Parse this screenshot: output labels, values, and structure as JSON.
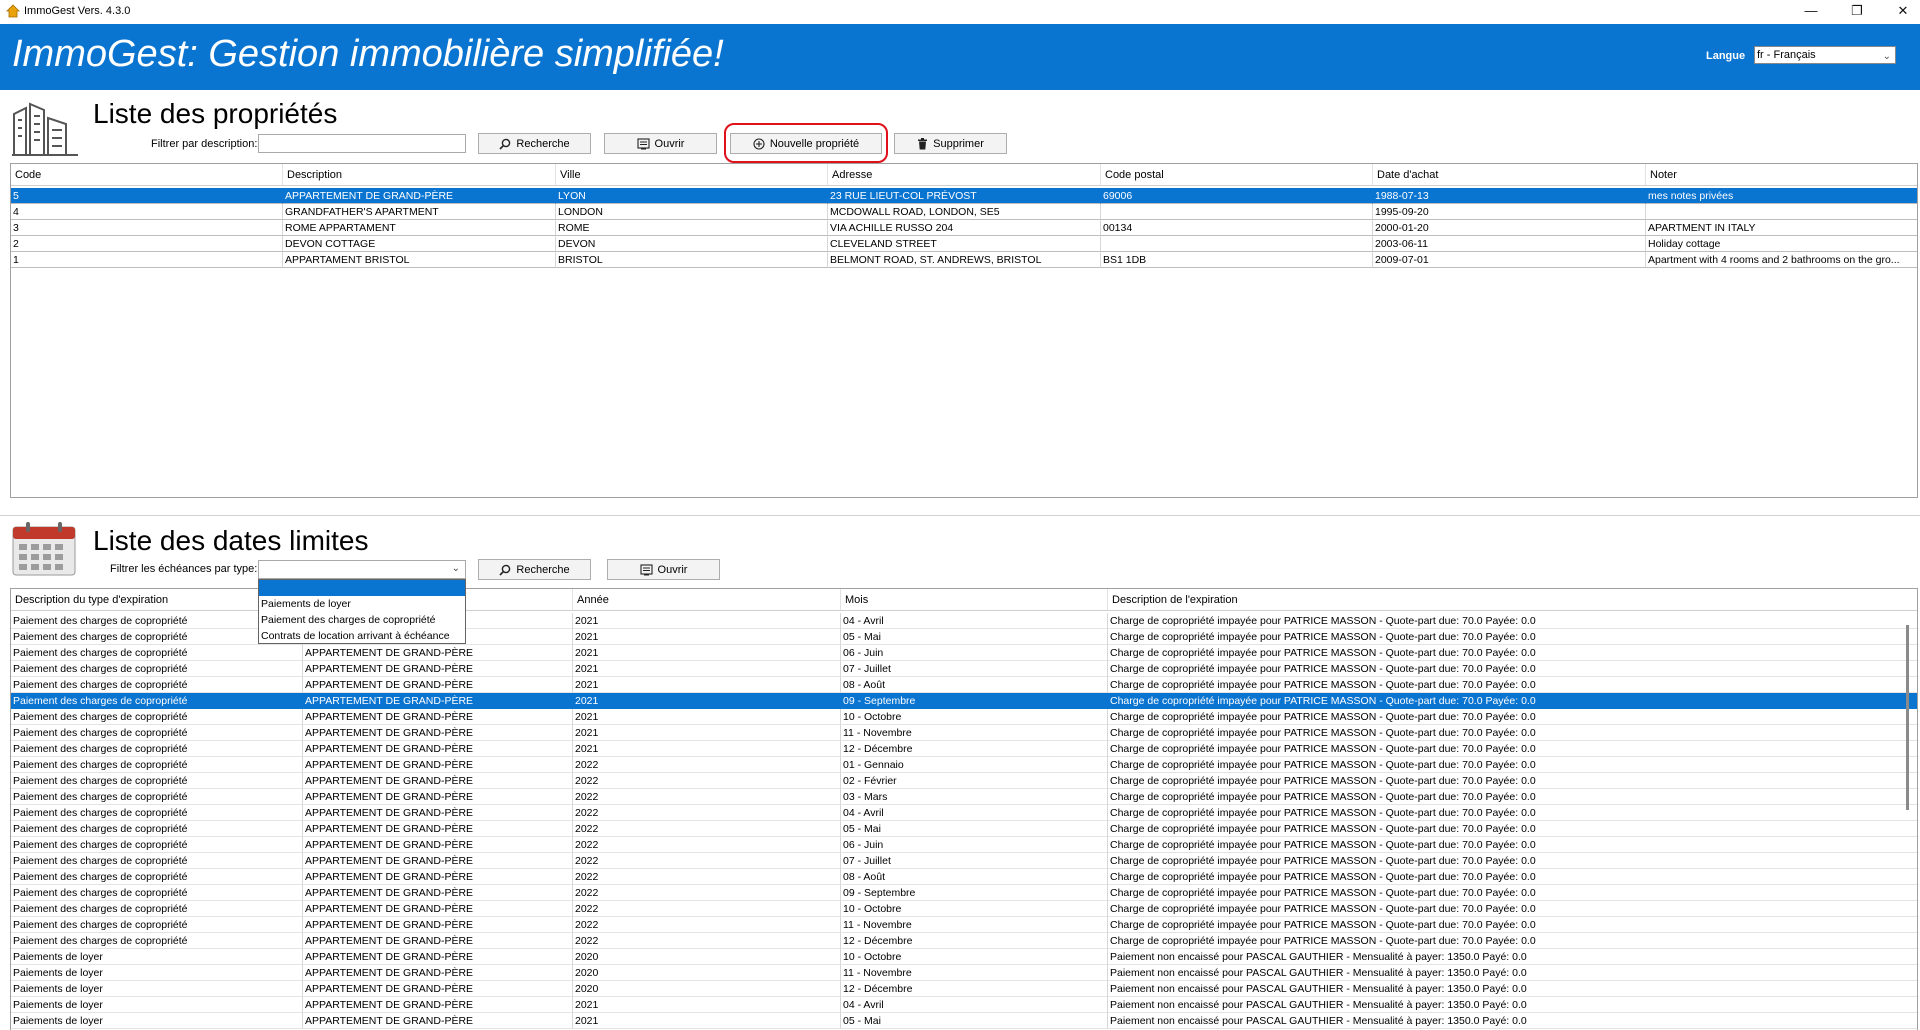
{
  "window": {
    "title": "ImmoGest Vers. 4.3.0"
  },
  "header": {
    "title": "ImmoGest: Gestion immobilière simplifiée!",
    "language_label": "Langue",
    "language_value": "fr - Français"
  },
  "properties": {
    "section_title": "Liste des propriétés",
    "filter_label": "Filtrer par description:",
    "filter_value": "",
    "buttons": {
      "search": "Recherche",
      "open": "Ouvrir",
      "new": "Nouvelle propriété",
      "delete": "Supprimer"
    },
    "columns": [
      "Code",
      "Description",
      "Ville",
      "Adresse",
      "Code postal",
      "Date d'achat",
      "Noter"
    ],
    "selected_row": 0,
    "rows": [
      [
        "5",
        "APPARTEMENT DE GRAND-PÈRE",
        "LYON",
        "23 RUE LIEUT-COL PRÉVOST",
        "69006",
        "1988-07-13",
        "mes notes privées"
      ],
      [
        "4",
        "GRANDFATHER'S APARTMENT",
        "LONDON",
        "MCDOWALL ROAD, LONDON, SE5",
        "",
        "1995-09-20",
        ""
      ],
      [
        "3",
        "ROME APPARTAMENT",
        "ROME",
        "VIA ACHILLE RUSSO 204",
        "00134",
        "2000-01-20",
        "APARTMENT IN ITALY"
      ],
      [
        "2",
        "DEVON COTTAGE",
        "DEVON",
        "CLEVELAND STREET",
        "",
        "2003-06-11",
        "Holiday cottage"
      ],
      [
        "1",
        "APPARTAMENT BRISTOL",
        "BRISTOL",
        "BELMONT ROAD, ST. ANDREWS, BRISTOL",
        "BS1 1DB",
        "2009-07-01",
        "Apartment with 4 rooms and 2 bathrooms on the gro..."
      ]
    ]
  },
  "deadlines": {
    "section_title": "Liste des dates limites",
    "filter_label": "Filtrer les échéances par type:",
    "filter_value": "",
    "type_options": [
      "",
      "Paiements de loyer",
      "Paiement des charges de copropriété",
      "Contrats de location arrivant à échéance"
    ],
    "buttons": {
      "search": "Recherche",
      "open": "Ouvrir"
    },
    "columns": [
      "Description du type d'expiration",
      "",
      "Année",
      "Mois",
      "Description de l'expiration"
    ],
    "selected_row": 5,
    "rows": [
      [
        "Paiement des charges de copropriété",
        "",
        "2021",
        "04 - Avril",
        "Charge de copropriété impayée pour PATRICE MASSON - Quote-part due: 70.0 Payée: 0.0"
      ],
      [
        "Paiement des charges de copropriété",
        "",
        "2021",
        "05 - Mai",
        "Charge de copropriété impayée pour PATRICE MASSON - Quote-part due: 70.0 Payée: 0.0"
      ],
      [
        "Paiement des charges de copropriété",
        "APPARTEMENT DE GRAND-PÈRE",
        "2021",
        "06 - Juin",
        "Charge de copropriété impayée pour PATRICE MASSON - Quote-part due: 70.0 Payée: 0.0"
      ],
      [
        "Paiement des charges de copropriété",
        "APPARTEMENT DE GRAND-PÈRE",
        "2021",
        "07 - Juillet",
        "Charge de copropriété impayée pour PATRICE MASSON - Quote-part due: 70.0 Payée: 0.0"
      ],
      [
        "Paiement des charges de copropriété",
        "APPARTEMENT DE GRAND-PÈRE",
        "2021",
        "08 - Août",
        "Charge de copropriété impayée pour PATRICE MASSON - Quote-part due: 70.0 Payée: 0.0"
      ],
      [
        "Paiement des charges de copropriété",
        "APPARTEMENT DE GRAND-PÈRE",
        "2021",
        "09 - Septembre",
        "Charge de copropriété impayée pour PATRICE MASSON - Quote-part due: 70.0 Payée: 0.0"
      ],
      [
        "Paiement des charges de copropriété",
        "APPARTEMENT DE GRAND-PÈRE",
        "2021",
        "10 - Octobre",
        "Charge de copropriété impayée pour PATRICE MASSON - Quote-part due: 70.0 Payée: 0.0"
      ],
      [
        "Paiement des charges de copropriété",
        "APPARTEMENT DE GRAND-PÈRE",
        "2021",
        "11 - Novembre",
        "Charge de copropriété impayée pour PATRICE MASSON - Quote-part due: 70.0 Payée: 0.0"
      ],
      [
        "Paiement des charges de copropriété",
        "APPARTEMENT DE GRAND-PÈRE",
        "2021",
        "12 - Décembre",
        "Charge de copropriété impayée pour PATRICE MASSON - Quote-part due: 70.0 Payée: 0.0"
      ],
      [
        "Paiement des charges de copropriété",
        "APPARTEMENT DE GRAND-PÈRE",
        "2022",
        "01 - Gennaio",
        "Charge de copropriété impayée pour PATRICE MASSON - Quote-part due: 70.0 Payée: 0.0"
      ],
      [
        "Paiement des charges de copropriété",
        "APPARTEMENT DE GRAND-PÈRE",
        "2022",
        "02 - Février",
        "Charge de copropriété impayée pour PATRICE MASSON - Quote-part due: 70.0 Payée: 0.0"
      ],
      [
        "Paiement des charges de copropriété",
        "APPARTEMENT DE GRAND-PÈRE",
        "2022",
        "03 - Mars",
        "Charge de copropriété impayée pour PATRICE MASSON - Quote-part due: 70.0 Payée: 0.0"
      ],
      [
        "Paiement des charges de copropriété",
        "APPARTEMENT DE GRAND-PÈRE",
        "2022",
        "04 - Avril",
        "Charge de copropriété impayée pour PATRICE MASSON - Quote-part due: 70.0 Payée: 0.0"
      ],
      [
        "Paiement des charges de copropriété",
        "APPARTEMENT DE GRAND-PÈRE",
        "2022",
        "05 - Mai",
        "Charge de copropriété impayée pour PATRICE MASSON - Quote-part due: 70.0 Payée: 0.0"
      ],
      [
        "Paiement des charges de copropriété",
        "APPARTEMENT DE GRAND-PÈRE",
        "2022",
        "06 - Juin",
        "Charge de copropriété impayée pour PATRICE MASSON - Quote-part due: 70.0 Payée: 0.0"
      ],
      [
        "Paiement des charges de copropriété",
        "APPARTEMENT DE GRAND-PÈRE",
        "2022",
        "07 - Juillet",
        "Charge de copropriété impayée pour PATRICE MASSON - Quote-part due: 70.0 Payée: 0.0"
      ],
      [
        "Paiement des charges de copropriété",
        "APPARTEMENT DE GRAND-PÈRE",
        "2022",
        "08 - Août",
        "Charge de copropriété impayée pour PATRICE MASSON - Quote-part due: 70.0 Payée: 0.0"
      ],
      [
        "Paiement des charges de copropriété",
        "APPARTEMENT DE GRAND-PÈRE",
        "2022",
        "09 - Septembre",
        "Charge de copropriété impayée pour PATRICE MASSON - Quote-part due: 70.0 Payée: 0.0"
      ],
      [
        "Paiement des charges de copropriété",
        "APPARTEMENT DE GRAND-PÈRE",
        "2022",
        "10 - Octobre",
        "Charge de copropriété impayée pour PATRICE MASSON - Quote-part due: 70.0 Payée: 0.0"
      ],
      [
        "Paiement des charges de copropriété",
        "APPARTEMENT DE GRAND-PÈRE",
        "2022",
        "11 - Novembre",
        "Charge de copropriété impayée pour PATRICE MASSON - Quote-part due: 70.0 Payée: 0.0"
      ],
      [
        "Paiement des charges de copropriété",
        "APPARTEMENT DE GRAND-PÈRE",
        "2022",
        "12 - Décembre",
        "Charge de copropriété impayée pour PATRICE MASSON - Quote-part due: 70.0 Payée: 0.0"
      ],
      [
        "Paiements de loyer",
        "APPARTEMENT DE GRAND-PÈRE",
        "2020",
        "10 - Octobre",
        "Paiement non encaissé pour PASCAL GAUTHIER - Mensualité à payer: 1350.0 Payé: 0.0"
      ],
      [
        "Paiements de loyer",
        "APPARTEMENT DE GRAND-PÈRE",
        "2020",
        "11 - Novembre",
        "Paiement non encaissé pour PASCAL GAUTHIER - Mensualité à payer: 1350.0 Payé: 0.0"
      ],
      [
        "Paiements de loyer",
        "APPARTEMENT DE GRAND-PÈRE",
        "2020",
        "12 - Décembre",
        "Paiement non encaissé pour PASCAL GAUTHIER - Mensualité à payer: 1350.0 Payé: 0.0"
      ],
      [
        "Paiements de loyer",
        "APPARTEMENT DE GRAND-PÈRE",
        "2021",
        "04 - Avril",
        "Paiement non encaissé pour PASCAL GAUTHIER - Mensualité à payer: 1350.0 Payé: 0.0"
      ],
      [
        "Paiements de loyer",
        "APPARTEMENT DE GRAND-PÈRE",
        "2021",
        "05 - Mai",
        "Paiement non encaissé pour PASCAL GAUTHIER - Mensualité à payer: 1350.0 Payé: 0.0"
      ]
    ]
  },
  "icons": [
    "app-house-icon",
    "minimize-icon",
    "restore-icon",
    "close-icon",
    "building-icon",
    "calendar-icon",
    "search-icon",
    "open-document-icon",
    "add-circle-icon",
    "trash-icon",
    "chevron-down-icon"
  ],
  "colors": {
    "header_blue": "#0a74d1",
    "selection_blue": "#0a74d1",
    "highlight_red": "#e0111b"
  }
}
